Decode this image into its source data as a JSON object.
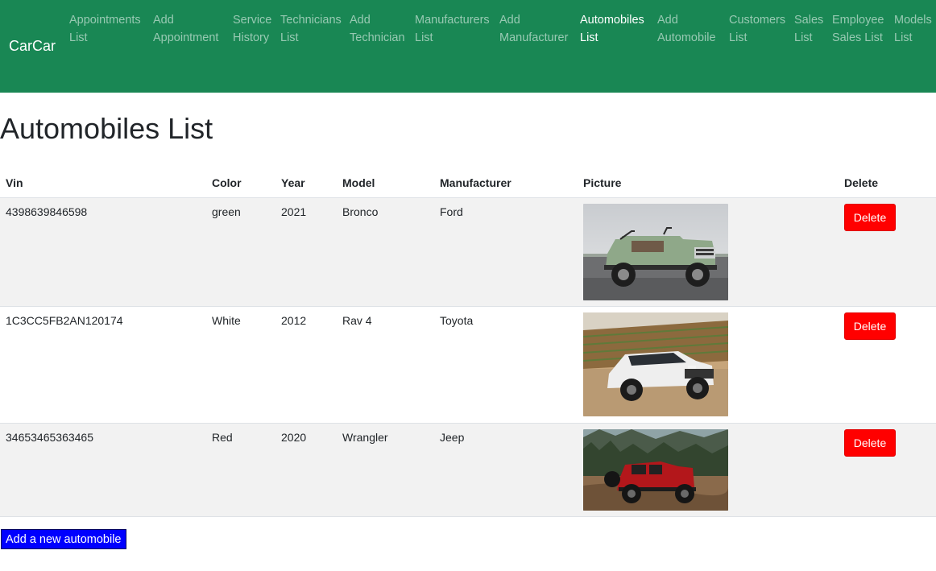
{
  "brand": "CarCar",
  "nav": [
    {
      "line1": "Appointments",
      "line2": "List",
      "active": false
    },
    {
      "line1": "Add",
      "line2": "Appointment",
      "active": false
    },
    {
      "line1": "Service",
      "line2": "History",
      "active": false
    },
    {
      "line1": "Technicians",
      "line2": "List",
      "active": false
    },
    {
      "line1": "Add",
      "line2": "Technician",
      "active": false
    },
    {
      "line1": "Manufacturers",
      "line2": "List",
      "active": false
    },
    {
      "line1": "Add",
      "line2": "Manufacturer",
      "active": false
    },
    {
      "line1": "Automobiles",
      "line2": "List",
      "active": true
    },
    {
      "line1": "Add",
      "line2": "Automobile",
      "active": false
    },
    {
      "line1": "Customers",
      "line2": "List",
      "active": false
    },
    {
      "line1": "Sales",
      "line2": "List",
      "active": false
    },
    {
      "line1": "Employee",
      "line2": "Sales List",
      "active": false
    },
    {
      "line1": "Models",
      "line2": "List",
      "active": false
    }
  ],
  "page_title": "Automobiles List",
  "table": {
    "headers": {
      "vin": "Vin",
      "color": "Color",
      "year": "Year",
      "model": "Model",
      "manufacturer": "Manufacturer",
      "picture": "Picture",
      "delete": "Delete"
    },
    "rows": [
      {
        "vin": "4398639846598",
        "color": "green",
        "year": "2021",
        "model": "Bronco",
        "manufacturer": "Ford",
        "picture_subject": "green-bronco-photo",
        "delete_label": "Delete"
      },
      {
        "vin": "1C3CC5FB2AN120174",
        "color": "White",
        "year": "2012",
        "model": "Rav 4",
        "manufacturer": "Toyota",
        "picture_subject": "white-rav4-photo",
        "delete_label": "Delete"
      },
      {
        "vin": "34653465363465",
        "color": "Red",
        "year": "2020",
        "model": "Wrangler",
        "manufacturer": "Jeep",
        "picture_subject": "red-wrangler-photo",
        "delete_label": "Delete"
      }
    ]
  },
  "add_button_label": "Add a new automobile",
  "colors": {
    "navbar": "#198754",
    "delete_button": "#ff0000",
    "add_button": "#0000ff",
    "striped_row": "#f2f2f2"
  }
}
